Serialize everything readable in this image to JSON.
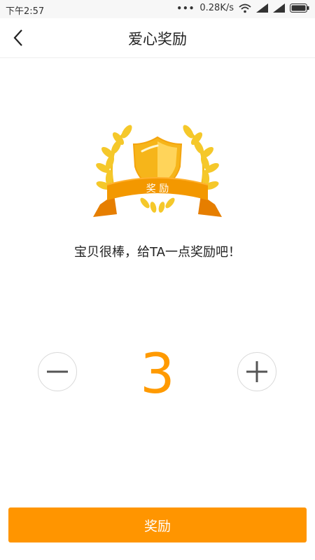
{
  "status": {
    "time": "下午2:57",
    "dots": "•••",
    "speed": "0.28K/s"
  },
  "nav": {
    "title": "爱心奖励"
  },
  "badge": {
    "ribbon_text": "奖 励"
  },
  "message": "宝贝很棒，给TA一点奖励吧！",
  "counter": {
    "value": "3"
  },
  "action": {
    "button_label": "奖励"
  },
  "colors": {
    "accent": "#ff9500",
    "badge_gold": "#f5c518",
    "ribbon": "#f39800"
  }
}
